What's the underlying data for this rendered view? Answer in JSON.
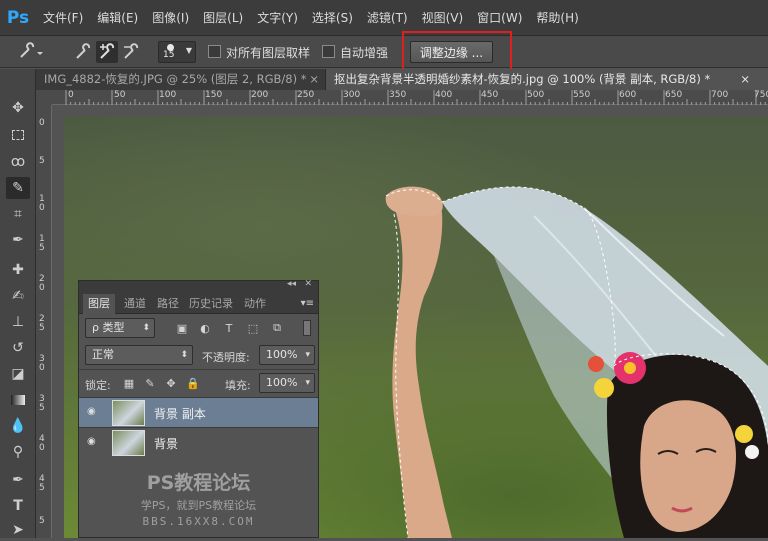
{
  "app": {
    "logo": "Ps"
  },
  "menu": [
    "文件(F)",
    "编辑(E)",
    "图像(I)",
    "图层(L)",
    "文字(Y)",
    "选择(S)",
    "滤镜(T)",
    "视图(V)",
    "窗口(W)",
    "帮助(H)"
  ],
  "options": {
    "brush_size": "15",
    "sample_all_layers": "对所有图层取样",
    "auto_enhance": "自动增强",
    "refine_edge": "调整边缘 ..."
  },
  "tabs": [
    {
      "label": "IMG_4882-恢复的.JPG @ 25% (图层 2, RGB/8) *",
      "close": "×"
    },
    {
      "label": "抠出复杂背景半透明婚纱素材-恢复的.jpg @ 100% (背景 副本, RGB/8) *",
      "close": "×"
    }
  ],
  "ruler_top": [
    "0",
    "50",
    "100",
    "150",
    "200",
    "250",
    "300",
    "350",
    "400",
    "450",
    "500",
    "550",
    "600",
    "650",
    "700",
    "750"
  ],
  "ruler_left": [
    "0",
    "5",
    "1\n0",
    "1\n5",
    "2\n0",
    "2\n5",
    "3\n0",
    "3\n5",
    "4\n0",
    "4\n5",
    "5"
  ],
  "layers_panel": {
    "tabs": [
      "图层",
      "通道",
      "路径",
      "历史记录",
      "动作"
    ],
    "filter_label": "ρ 类型",
    "blend_mode": "正常",
    "opacity_label": "不透明度:",
    "opacity_value": "100%",
    "lock_label": "锁定:",
    "fill_label": "填充:",
    "fill_value": "100%",
    "layers": [
      {
        "name": "背景 副本",
        "selected": true
      },
      {
        "name": "背景",
        "selected": false
      }
    ],
    "watermark": {
      "title": "PS教程论坛",
      "subtitle": "学PS，就到PS教程论坛",
      "url": "BBS.16XX8.COM"
    }
  }
}
